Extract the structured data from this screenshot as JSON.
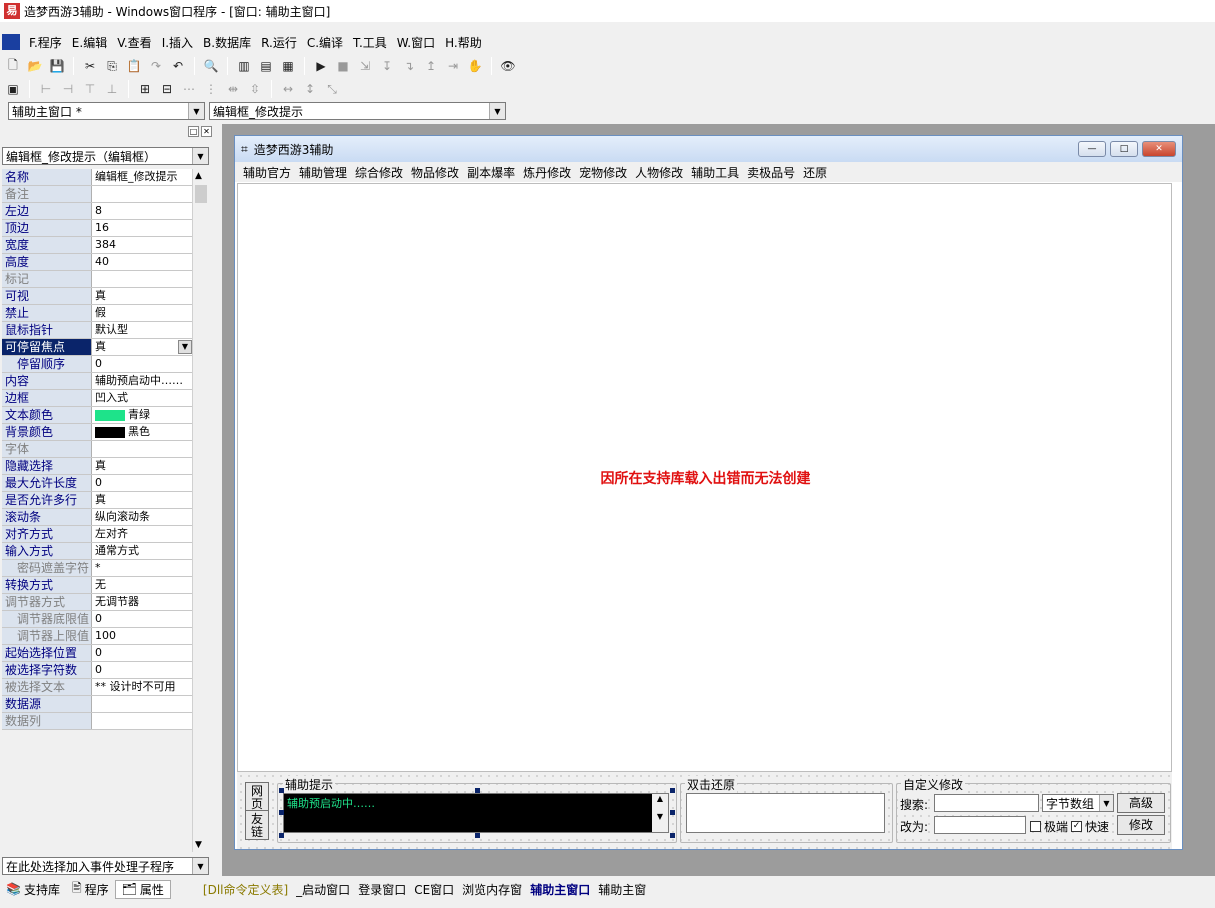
{
  "window": {
    "title": "造梦西游3辅助 - Windows窗口程序 - [窗口: 辅助主窗口]"
  },
  "menu": [
    "F.程序",
    "E.编辑",
    "V.查看",
    "I.插入",
    "B.数据库",
    "R.运行",
    "C.编译",
    "T.工具",
    "W.窗口",
    "H.帮助"
  ],
  "toolbar": {
    "window_combo": "辅助主窗口 *",
    "component_combo": "编辑框_修改提示"
  },
  "left_panel": {
    "object_combo": "编辑框_修改提示（编辑框）",
    "properties": [
      {
        "name": "名称",
        "value": "编辑框_修改提示"
      },
      {
        "name": "备注",
        "value": ""
      },
      {
        "name": "左边",
        "value": "8"
      },
      {
        "name": "顶边",
        "value": "16"
      },
      {
        "name": "宽度",
        "value": "384"
      },
      {
        "name": "高度",
        "value": "40"
      },
      {
        "name": "标记",
        "value": ""
      },
      {
        "name": "可视",
        "value": "真"
      },
      {
        "name": "禁止",
        "value": "假"
      },
      {
        "name": "鼠标指针",
        "value": "默认型"
      },
      {
        "name": "可停留焦点",
        "value": "真"
      },
      {
        "name": "停留顺序",
        "value": "0"
      },
      {
        "name": "内容",
        "value": "辅助预启动中……"
      },
      {
        "name": "边框",
        "value": "凹入式"
      },
      {
        "name": "文本颜色",
        "value": "青绿"
      },
      {
        "name": "背景颜色",
        "value": "黑色"
      },
      {
        "name": "字体",
        "value": ""
      },
      {
        "name": "隐藏选择",
        "value": "真"
      },
      {
        "name": "最大允许长度",
        "value": "0"
      },
      {
        "name": "是否允许多行",
        "value": "真"
      },
      {
        "name": "滚动条",
        "value": "纵向滚动条"
      },
      {
        "name": "对齐方式",
        "value": "左对齐"
      },
      {
        "name": "输入方式",
        "value": "通常方式"
      },
      {
        "name": "密码遮盖字符",
        "value": "*"
      },
      {
        "name": "转换方式",
        "value": "无"
      },
      {
        "name": "调节器方式",
        "value": "无调节器"
      },
      {
        "name": "调节器底限值",
        "value": "0"
      },
      {
        "name": "调节器上限值",
        "value": "100"
      },
      {
        "name": "起始选择位置",
        "value": "0"
      },
      {
        "name": "被选择字符数",
        "value": "0"
      },
      {
        "name": "被选择文本",
        "value": "** 设计时不可用"
      },
      {
        "name": "数据源",
        "value": ""
      },
      {
        "name": "数据列",
        "value": ""
      }
    ],
    "text_color": "#1ee38a",
    "back_color": "#000000",
    "event_combo": "在此处选择加入事件处理子程序",
    "tabs": [
      "支持库",
      "程序",
      "属性"
    ]
  },
  "form": {
    "title": "造梦西游3辅助",
    "menu": [
      "辅助官方",
      "辅助管理",
      "综合修改",
      "物品修改",
      "副本爆率",
      "炼丹修改",
      "宠物修改",
      "人物修改",
      "辅助工具",
      "卖极品号",
      "还原"
    ],
    "error_message": "因所在支持库载入出错而无法创建",
    "left_buttons": [
      "网页",
      "友链"
    ],
    "group_hint": "辅助提示",
    "hint_text": "辅助预启动中……",
    "group_restore": "双击还原",
    "group_custom": "自定义修改",
    "search_label": "搜索:",
    "change_label": "改为:",
    "type_combo": "字节数组",
    "advanced_button": "高级",
    "modify_button": "修改",
    "check_extreme": "极端",
    "check_fast": "快速"
  },
  "window_tabs": [
    "[Dll命令定义表]",
    "_启动窗口",
    "登录窗口",
    "CE窗口",
    "浏览内存窗",
    "辅助主窗口",
    "辅助主窗"
  ]
}
